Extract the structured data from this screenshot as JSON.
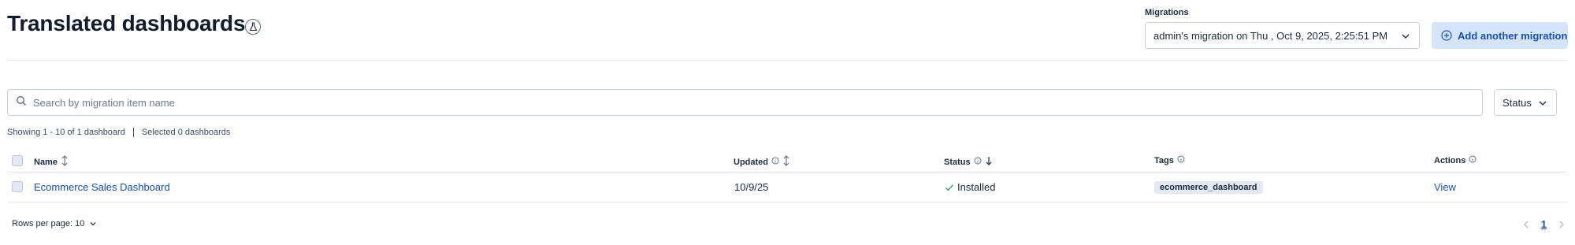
{
  "page": {
    "title": "Translated dashboards"
  },
  "migrations": {
    "label": "Migrations",
    "selected": "admin's migration on Thu , Oct 9, 2025, 2:25:51 PM",
    "add_button": "Add another migration"
  },
  "search": {
    "placeholder": "Search by migration item name",
    "value": ""
  },
  "filters": {
    "status_label": "Status"
  },
  "summary": {
    "showing": "Showing 1 - 10 of 1 dashboard",
    "selected": "Selected 0 dashboards"
  },
  "table": {
    "columns": {
      "name": "Name",
      "updated": "Updated",
      "status": "Status",
      "tags": "Tags",
      "actions": "Actions"
    },
    "rows": [
      {
        "name": "Ecommerce Sales Dashboard",
        "updated": "10/9/25",
        "status": "Installed",
        "tag": "ecommerce_dashboard",
        "action": "View"
      }
    ]
  },
  "pagination": {
    "rows_per_page": "Rows per page: 10",
    "current_page": "1"
  },
  "colors": {
    "accent": "#1750ba",
    "success": "#3ba37f",
    "border": "#cad3e2"
  }
}
